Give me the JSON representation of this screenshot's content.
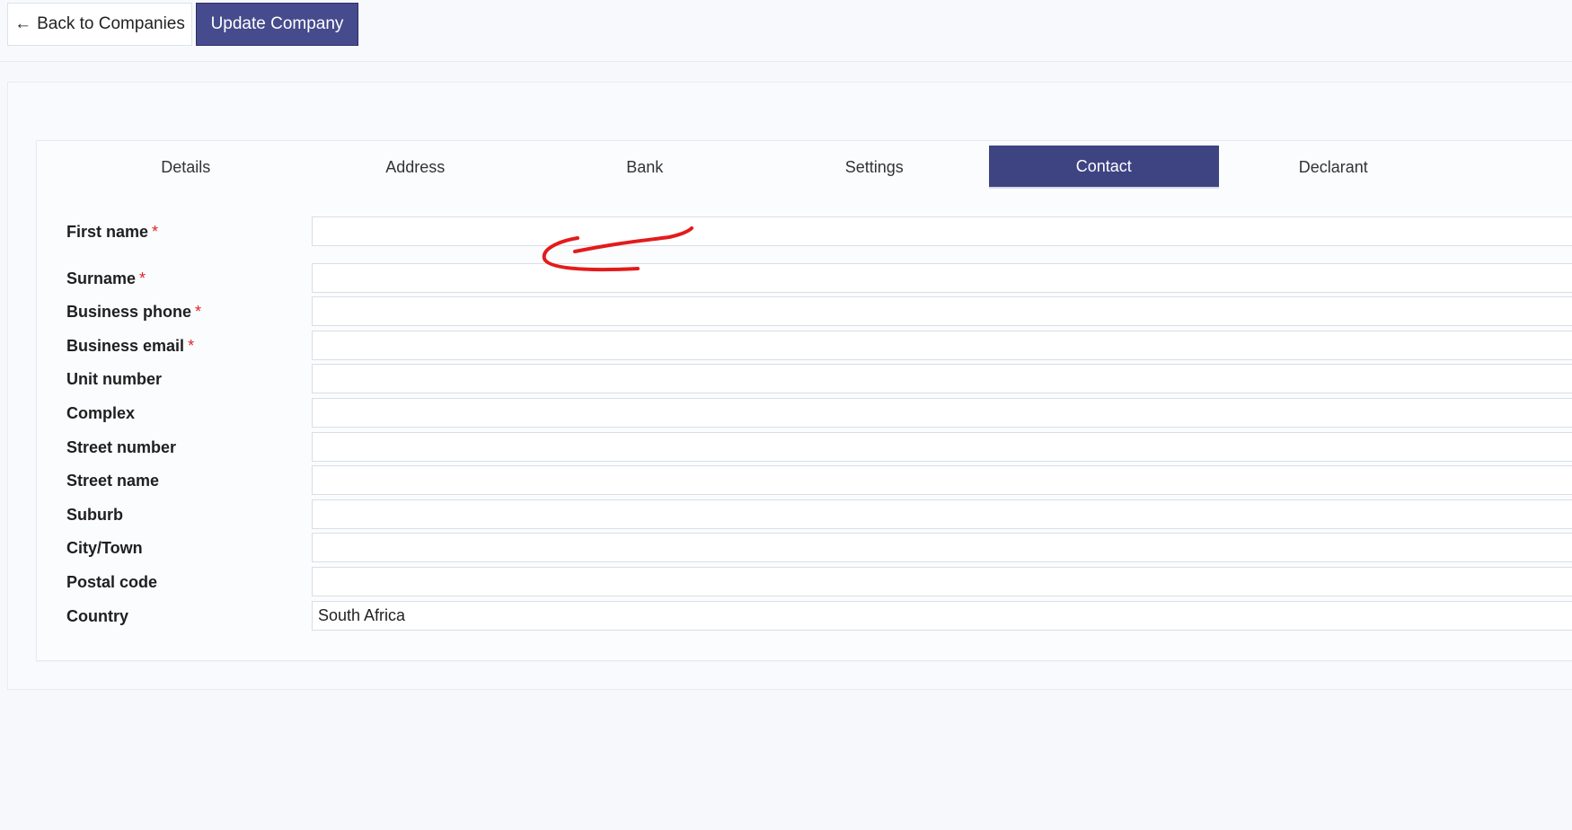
{
  "toolbar": {
    "back_arrow": "←",
    "back_label": "Back to Companies",
    "update_label": "Update Company",
    "accent_color": "#454b8c"
  },
  "tabs": [
    {
      "label": "Details",
      "active": false
    },
    {
      "label": "Address",
      "active": false
    },
    {
      "label": "Bank",
      "active": false
    },
    {
      "label": "Settings",
      "active": false
    },
    {
      "label": "Contact",
      "active": true
    },
    {
      "label": "Declarant",
      "active": false
    }
  ],
  "form": {
    "required_marker": "*",
    "fields": [
      {
        "label": "First name",
        "required": true,
        "value": ""
      },
      {
        "label": "Surname",
        "required": true,
        "value": ""
      },
      {
        "label": "Business phone",
        "required": true,
        "value": ""
      },
      {
        "label": "Business email",
        "required": true,
        "value": ""
      },
      {
        "label": "Unit number",
        "required": false,
        "value": ""
      },
      {
        "label": "Complex",
        "required": false,
        "value": ""
      },
      {
        "label": "Street number",
        "required": false,
        "value": ""
      },
      {
        "label": "Street name",
        "required": false,
        "value": ""
      },
      {
        "label": "Suburb",
        "required": false,
        "value": ""
      },
      {
        "label": "City/Town",
        "required": false,
        "value": ""
      },
      {
        "label": "Postal code",
        "required": false,
        "value": ""
      },
      {
        "label": "Country",
        "required": false,
        "value": "South Africa"
      }
    ]
  },
  "annotation": {
    "type": "hand-drawn-arrow",
    "color": "#e31b1b",
    "points_to": "First name"
  }
}
